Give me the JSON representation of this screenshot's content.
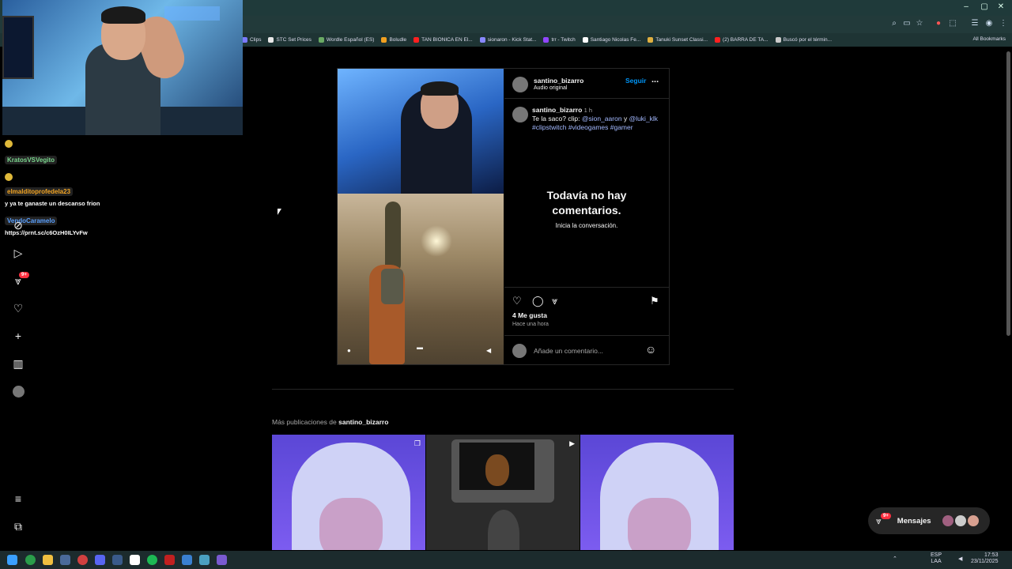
{
  "browser": {
    "bookmarks": [
      {
        "label": "Clips",
        "color": "#7a7aff"
      },
      {
        "label": "STC Set Prices",
        "color": "#e8e8e8"
      },
      {
        "label": "Wordle Español (ES)",
        "color": "#6aaa64"
      },
      {
        "label": "Boludle",
        "color": "#f0a020"
      },
      {
        "label": "TAN BIONICA EN El...",
        "color": "#ff2020"
      },
      {
        "label": "sionaron - Kick Stat...",
        "color": "#8888ff"
      },
      {
        "label": "trr - Twitch",
        "color": "#9146ff"
      },
      {
        "label": "Santiago Nicolas Fe...",
        "color": "#ffffff"
      },
      {
        "label": "Tanuki Sunset Classi...",
        "color": "#e0b040"
      },
      {
        "label": "(2) BARRA DE TA...",
        "color": "#ff2020"
      },
      {
        "label": "Buscó por el términ...",
        "color": "#cccccc"
      }
    ],
    "all_bookmarks": "All Bookmarks"
  },
  "chat": [
    {
      "user": "KratosVSVegito",
      "user_color": "#7bd88f",
      "message": ""
    },
    {
      "user": "elmalditoprofedela23",
      "user_color": "#f5a623",
      "message": "y ya te ganaste un descanso frion"
    },
    {
      "user": "VendoCaramelo",
      "user_color": "#5aa0ff",
      "message": "https://prnt.sc/c6OzH0ILYvFw"
    }
  ],
  "sidebar": {
    "notifications_badge": "9+"
  },
  "post": {
    "author": "santino_bizarro",
    "audio": "Audio original",
    "follow_label": "Seguir",
    "more": "...",
    "caption_time": "1 h",
    "caption_prefix": "Te la saco? clip:",
    "mention1": "@sion_aaron",
    "conj": "y",
    "mention2": "@luki_klk",
    "hashtags": "#clipstwitch #videogames #gamer",
    "empty_title_line1": "Todavía no hay",
    "empty_title_line2": "comentarios.",
    "empty_sub": "Inicia la conversación.",
    "likes": "4 Me gusta",
    "posted": "Hace una hora",
    "comment_placeholder": "Añade un comentario..."
  },
  "more_posts": {
    "prefix": "Más publicaciones de",
    "author": "santino_bizarro"
  },
  "messages": {
    "label": "Mensajes",
    "badge": "9+"
  },
  "taskbar": {
    "lang": "ESP",
    "lang2": "LAA",
    "time": "17:53",
    "date": "23/11/2025"
  }
}
